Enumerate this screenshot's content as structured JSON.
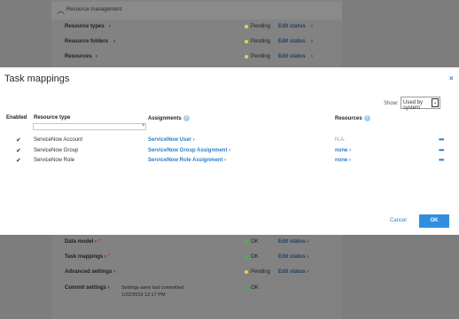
{
  "background_top": {
    "section_label": "Resource management",
    "rows": [
      {
        "name": "Resource types",
        "status": "Pending",
        "edit": "Edit status"
      },
      {
        "name": "Resource folders",
        "status": "Pending",
        "edit": "Edit status"
      },
      {
        "name": "Resources",
        "status": "Pending",
        "edit": "Edit status"
      }
    ]
  },
  "modal": {
    "title": "Task mappings",
    "close": "×",
    "show_label": "Show:",
    "show_value": "Used by system",
    "columns": {
      "enabled": "Enabled",
      "resource_type": "Resource type",
      "assignments": "Assignments",
      "resources": "Resources"
    },
    "filter_clear": "×",
    "rows": [
      {
        "enabled": "✔",
        "resource_type": "ServiceNow Account",
        "assignment": "ServiceNow User",
        "resources": "N.A."
      },
      {
        "enabled": "✔",
        "resource_type": "ServiceNow Group",
        "assignment": "ServiceNow Group Assignment",
        "resources": "none"
      },
      {
        "enabled": "✔",
        "resource_type": "ServiceNow Role",
        "assignment": "ServiceNow Role Assignment",
        "resources": "none"
      }
    ],
    "more": "•••",
    "cancel": "Cancel",
    "ok": "OK"
  },
  "background_bottom": {
    "rows": [
      {
        "name": "Data model",
        "required": "*",
        "status": "OK",
        "edit": "Edit status"
      },
      {
        "name": "Task mappings",
        "required": "*",
        "status": "OK",
        "edit": "Edit status"
      },
      {
        "name": "Advanced settings",
        "required": "",
        "status": "Pending",
        "edit": "Edit status"
      },
      {
        "name": "Commit settings",
        "required": "",
        "status": "OK",
        "edit": "",
        "note": "Settings were last committed",
        "note_date": "1/22/2019 12:17 PM"
      }
    ]
  },
  "colors": {
    "pending": "#e8d34a",
    "ok": "#3db84a",
    "accent": "#2a7fcb"
  }
}
